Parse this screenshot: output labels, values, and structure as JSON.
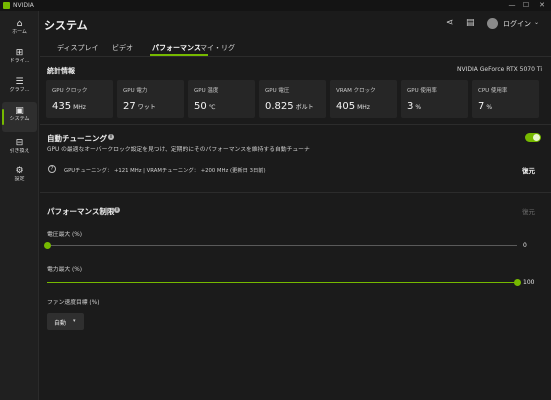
{
  "app": {
    "title": "NVIDIA"
  },
  "window": {
    "minimize": "—",
    "maximize": "☐",
    "close": "✕"
  },
  "sidebar": {
    "items": [
      {
        "label": "ホーム",
        "icon": "home-icon",
        "glyph": "⌂"
      },
      {
        "label": "ドライ...",
        "icon": "driver-icon",
        "glyph": "⊞"
      },
      {
        "label": "グラフ...",
        "icon": "graphics-sliders-icon",
        "glyph": "☰"
      },
      {
        "label": "システム",
        "icon": "system-monitor-icon",
        "glyph": "▣"
      },
      {
        "label": "引き換え",
        "icon": "gift-icon",
        "glyph": "⊟"
      },
      {
        "label": "設定",
        "icon": "gear-icon",
        "glyph": "⚙"
      }
    ],
    "active_index": 3
  },
  "header": {
    "title": "システム",
    "share_icon": "⋖",
    "feedback_icon": "▤",
    "login": "ログイン",
    "login_chevron": "⌄"
  },
  "tabs": [
    {
      "label": "ディスプレイ"
    },
    {
      "label": "ビデオ"
    },
    {
      "label": "パフォーマンス"
    },
    {
      "label": "マイ・リグ"
    }
  ],
  "active_tab": "パフォーマンス",
  "stats": {
    "title": "統計情報",
    "gpu_name": "NVIDIA GeForce RTX 5070 Ti",
    "cards": [
      {
        "label": "GPU クロック",
        "value": "435",
        "unit": "MHz"
      },
      {
        "label": "GPU 電力",
        "value": "27",
        "unit": "ワット"
      },
      {
        "label": "GPU 温度",
        "value": "50",
        "unit": "℃"
      },
      {
        "label": "GPU 電圧",
        "value": "0.825",
        "unit": "ボルト"
      },
      {
        "label": "VRAM クロック",
        "value": "405",
        "unit": "MHz"
      },
      {
        "label": "GPU 使用率",
        "value": "3",
        "unit": "%"
      },
      {
        "label": "CPU 使用率",
        "value": "7",
        "unit": "%"
      }
    ]
  },
  "auto_tuning": {
    "title": "自動チューニング",
    "description": "GPU の最適なオーバークロック設定を見つけ、定期的にそのパフォーマンスを維持する自動チューナ",
    "enabled": true,
    "result": "GPUチューニング： +121 MHz  |  VRAMチューニング： +200 MHz (更新日 3日前)",
    "restore": "復元"
  },
  "perf_limits": {
    "title": "パフォーマンス制限",
    "restore": "復元",
    "voltage": {
      "label": "電圧最大 (%)",
      "value": 0,
      "display": "0"
    },
    "power": {
      "label": "電力最大 (%)",
      "value": 100,
      "display": "100"
    },
    "fan": {
      "label": "ファン速度目標 (%)",
      "value": "自動",
      "chevron": "▾"
    }
  },
  "colors": {
    "accent": "#76b900",
    "background": "#1b1b1b",
    "card": "#262626"
  }
}
